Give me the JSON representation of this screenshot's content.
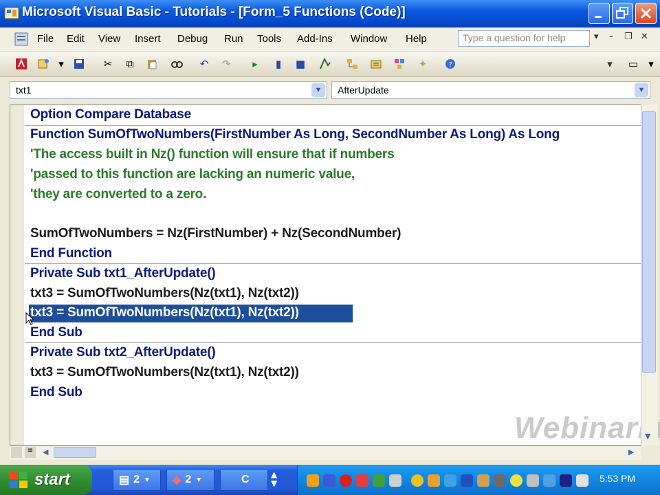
{
  "window": {
    "title": "Microsoft Visual Basic - Tutorials - [Form_5 Functions (Code)]",
    "caption_buttons": [
      "minimize-icon",
      "restore-icon",
      "close-icon"
    ]
  },
  "menu": {
    "items": [
      "File",
      "Edit",
      "View",
      "Insert",
      "Debug",
      "Run",
      "Tools",
      "Add-Ins",
      "Window",
      "Help"
    ],
    "help_placeholder": "Type a question for help"
  },
  "toolbar": {
    "icons": [
      "access-icon",
      "insert-module-icon",
      "save-icon",
      "cut-icon",
      "copy-icon",
      "paste-icon",
      "find-icon",
      "undo-icon",
      "redo-icon",
      "run-icon",
      "break-icon",
      "reset-icon",
      "design-mode-icon",
      "project-explorer-icon",
      "properties-icon",
      "object-browser-icon",
      "toolbox-icon",
      "help-icon"
    ]
  },
  "combos": {
    "object": "txt1",
    "procedure": "AfterUpdate"
  },
  "code": {
    "lines": [
      {
        "text": "Option Compare Database",
        "kind": "keyword"
      },
      {
        "text": "Function SumOfTwoNumbers(FirstNumber As Long, SecondNumber As Long) As Long",
        "kind": "mixed"
      },
      {
        "text": "'The access built in Nz() function will ensure that if numbers",
        "kind": "comment"
      },
      {
        "text": "'passed to this function are lacking an numeric value,",
        "kind": "comment"
      },
      {
        "text": "'they are converted to a zero.",
        "kind": "comment"
      },
      {
        "text": "",
        "kind": "blank"
      },
      {
        "text": "SumOfTwoNumbers = Nz(FirstNumber) + Nz(SecondNumber)",
        "kind": "plain"
      },
      {
        "text": "End Function",
        "kind": "keyword"
      },
      {
        "text": "Private Sub txt1_AfterUpdate()",
        "kind": "mixed"
      },
      {
        "text": "txt3 = SumOfTwoNumbers(Nz(txt1), Nz(txt2))",
        "kind": "plain"
      },
      {
        "text": "txt3 = SumOfTwoNumbers(Nz(txt1), Nz(txt2))",
        "kind": "selected"
      },
      {
        "text": "End Sub",
        "kind": "keyword"
      },
      {
        "text": "Private Sub txt2_AfterUpdate()",
        "kind": "mixed"
      },
      {
        "text": "txt3 = SumOfTwoNumbers(Nz(txt1), Nz(txt2))",
        "kind": "plain"
      },
      {
        "text": "End Sub",
        "kind": "keyword"
      }
    ]
  },
  "watermark": "Webinaria",
  "taskbar": {
    "start_label": "start",
    "groups": [
      {
        "icon": "explorer-group-icon",
        "count": "2"
      },
      {
        "icon": "access-group-icon",
        "count": "2"
      }
    ],
    "language": "C",
    "clock": "5:53 PM"
  },
  "colors": {
    "keyword": "#0b1a7a",
    "comment": "#2b7a2b",
    "selection": "#1d4e9a",
    "titlebar": "#0a58e0",
    "start_button": "#2e8a2e"
  }
}
